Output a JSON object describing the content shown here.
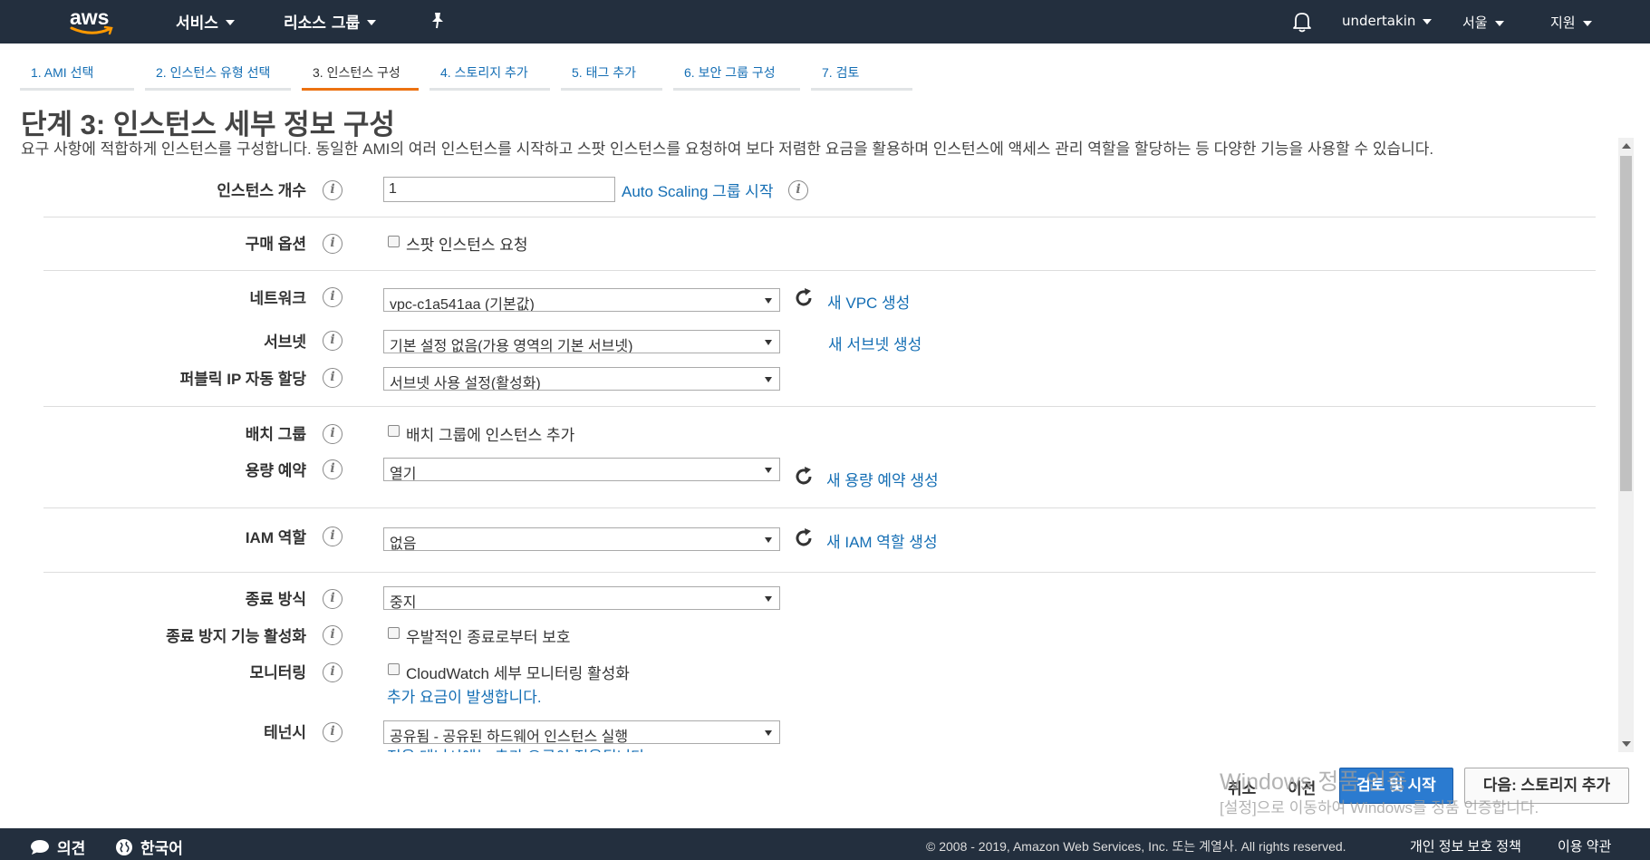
{
  "topbar": {
    "logo_text": "aws",
    "services": "서비스",
    "resource_groups": "리소스 그룹",
    "user": "undertakin",
    "region": "서울",
    "support": "지원"
  },
  "steps": [
    {
      "label": "1. AMI 선택"
    },
    {
      "label": "2. 인스턴스 유형 선택"
    },
    {
      "label": "3. 인스턴스 구성"
    },
    {
      "label": "4. 스토리지 추가"
    },
    {
      "label": "5. 태그 추가"
    },
    {
      "label": "6. 보안 그룹 구성"
    },
    {
      "label": "7. 검토"
    }
  ],
  "active_step": 3,
  "page": {
    "title": "단계 3: 인스턴스 세부 정보 구성",
    "description": "요구 사항에 적합하게 인스턴스를 구성합니다. 동일한 AMI의 여러 인스턴스를 시작하고 스팟 인스턴스를 요청하여 보다 저렴한 요금을 활용하며 인스턴스에 액세스 관리 역할을 할당하는 등 다양한 기능을 사용할 수 있습니다."
  },
  "form": {
    "instance_count": {
      "label": "인스턴스 개수",
      "value": "1",
      "link": "Auto Scaling 그룹 시작"
    },
    "purchase_option": {
      "label": "구매 옵션",
      "checkbox": "스팟 인스턴스 요청"
    },
    "network": {
      "label": "네트워크",
      "value": "vpc-c1a541aa (기본값)",
      "link": "새 VPC 생성"
    },
    "subnet": {
      "label": "서브넷",
      "value": "기본 설정 없음(가용 영역의 기본 서브넷)",
      "link": "새 서브넷 생성"
    },
    "public_ip": {
      "label": "퍼블릭 IP 자동 할당",
      "value": "서브넷 사용 설정(활성화)"
    },
    "placement_group": {
      "label": "배치 그룹",
      "checkbox": "배치 그룹에 인스턴스 추가"
    },
    "capacity_reservation": {
      "label": "용량 예약",
      "value": "열기",
      "link": "새 용량 예약 생성"
    },
    "iam_role": {
      "label": "IAM 역할",
      "value": "없음",
      "link": "새 IAM 역할 생성"
    },
    "shutdown_behavior": {
      "label": "종료 방식",
      "value": "중지"
    },
    "termination_protection": {
      "label": "종료 방지 기능 활성화",
      "checkbox": "우발적인 종료로부터 보호"
    },
    "monitoring": {
      "label": "모니터링",
      "checkbox": "CloudWatch 세부 모니터링 활성화",
      "note": "추가 요금이 발생합니다."
    },
    "tenancy": {
      "label": "테넌시",
      "value": "공유됨 - 공유된 하드웨어 인스턴스 실행",
      "note": "전용 테넌시에는 추가 요금이 적용됩니다."
    }
  },
  "buttons": {
    "cancel": "취소",
    "previous": "이전",
    "review_launch": "검토 및 시작",
    "next": "다음: 스토리지 추가"
  },
  "watermark": {
    "line1": "Windows 정품 인증",
    "line2": "[설정]으로 이동하여 Windows를 정품 인증합니다."
  },
  "footer": {
    "feedback": "의견",
    "language": "한국어",
    "copyright": "© 2008 - 2019, Amazon Web Services, Inc. 또는 계열사. All rights reserved.",
    "privacy": "개인 정보 보호 정책",
    "terms": "이용 약관"
  },
  "colors": {
    "topbar_bg": "#232f3e",
    "link": "#146eb4",
    "active_step_underline": "#ec7211",
    "primary_button": "#2b7bd0"
  }
}
